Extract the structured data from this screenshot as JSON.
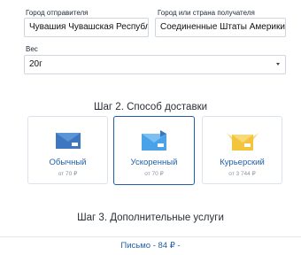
{
  "form": {
    "sender_city_label": "Город отправителя",
    "sender_city_value": "Чувашия Чувашская Республик",
    "recipient_label": "Город или страна получателя",
    "recipient_value": "Соединенные Штаты Америки",
    "weight_label": "Вес",
    "weight_value": "20г"
  },
  "step2": {
    "title": "Шаг 2. Способ доставки",
    "options": [
      {
        "name": "Обычный",
        "price": "от 70 ₽",
        "icon": "envelope-icon",
        "selected": false
      },
      {
        "name": "Ускоренный",
        "price": "от 70 ₽",
        "icon": "fast-envelope-icon",
        "selected": true
      },
      {
        "name": "Курьерский",
        "price": "от 3 744 ₽",
        "icon": "winged-envelope-icon",
        "selected": false
      }
    ]
  },
  "step3": {
    "title": "Шаг 3. Дополнительные услуги"
  },
  "summary": {
    "text": "Письмо - 84 ₽ -"
  },
  "colors": {
    "accent": "#1f5fa8",
    "envelope_blue": "#3d77c2",
    "envelope_light": "#4aa3e8",
    "envelope_yellow": "#f2c53d"
  }
}
